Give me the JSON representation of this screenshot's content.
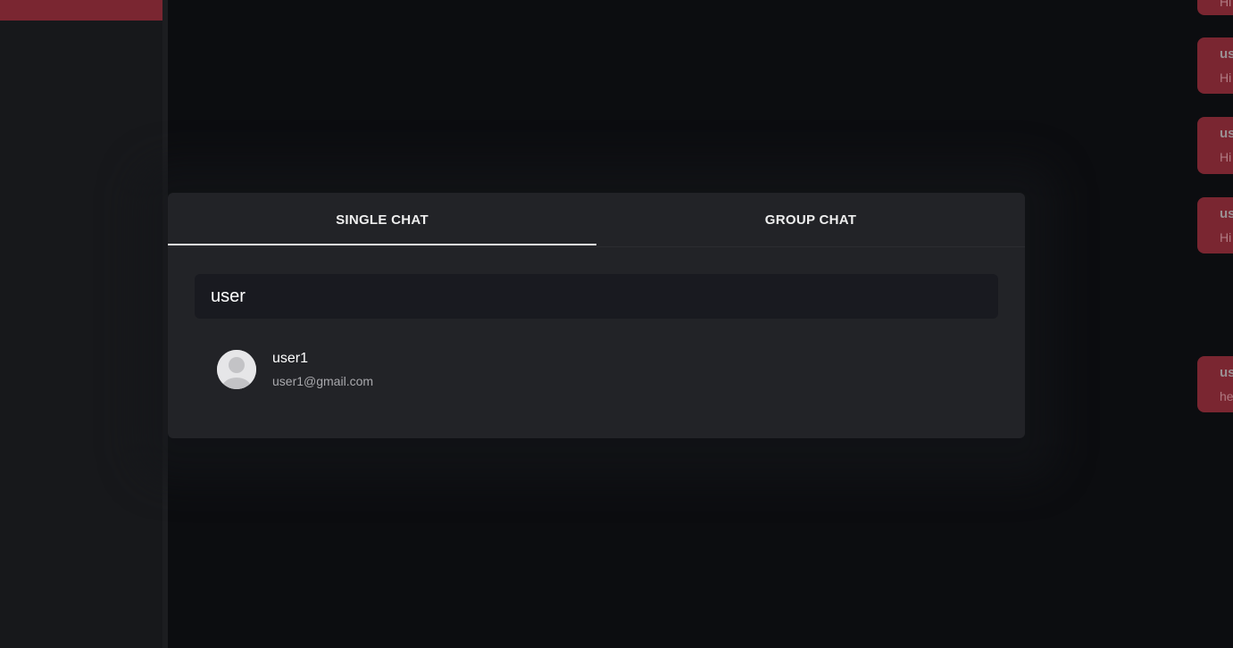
{
  "modal": {
    "tabs": [
      {
        "label": "SINGLE CHAT",
        "active": true
      },
      {
        "label": "GROUP CHAT",
        "active": false
      }
    ],
    "search": {
      "value": "user",
      "placeholder": ""
    },
    "results": [
      {
        "name": "user1",
        "email": "user1@gmail.com",
        "avatar_icon": "default-user-avatar"
      }
    ]
  },
  "background_messages": [
    {
      "sender": "",
      "text": "Hi"
    },
    {
      "sender": "us",
      "text": "Hi"
    },
    {
      "sender": "us",
      "text": "Hi"
    },
    {
      "sender": "us",
      "text": "Hi"
    },
    {
      "sender": "us",
      "text": "he"
    }
  ],
  "colors": {
    "accent": "#7a2631",
    "modal_bg": "#222327",
    "app_bg": "#0c0d10"
  }
}
